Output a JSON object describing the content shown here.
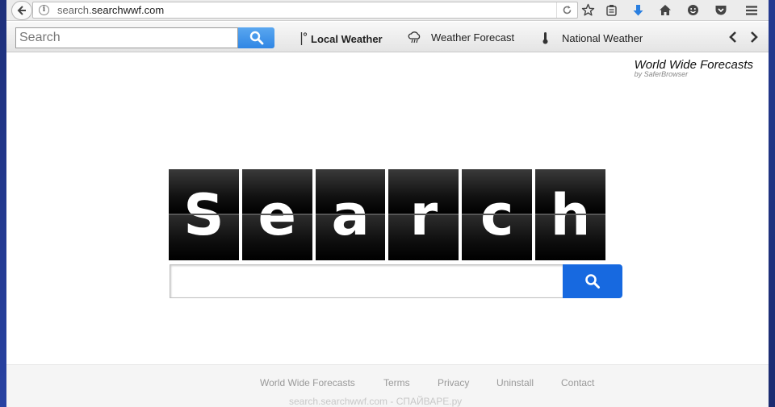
{
  "browser": {
    "url_prefix": "search.",
    "url_host": "searchwwf.com"
  },
  "toolbar": {
    "search_placeholder": "Search",
    "links": {
      "local_weather": "Local Weather",
      "weather_forecast": "Weather Forecast",
      "national_weather": "National Weather"
    }
  },
  "brand": {
    "title": "World Wide Forecasts",
    "subtitle": "by SaferBrowser"
  },
  "logo": {
    "letters": [
      "S",
      "e",
      "a",
      "r",
      "c",
      "h"
    ]
  },
  "footer": {
    "links": {
      "wwf": "World Wide Forecasts",
      "terms": "Terms",
      "privacy": "Privacy",
      "uninstall": "Uninstall",
      "contact": "Contact"
    },
    "watermark": "search.searchwwf.com - СПАЙВАРЕ.ру"
  },
  "colors": {
    "search_button": "#1769e0",
    "toolbar_button": "#2f86e4",
    "desktop": "#1d2f7a"
  }
}
